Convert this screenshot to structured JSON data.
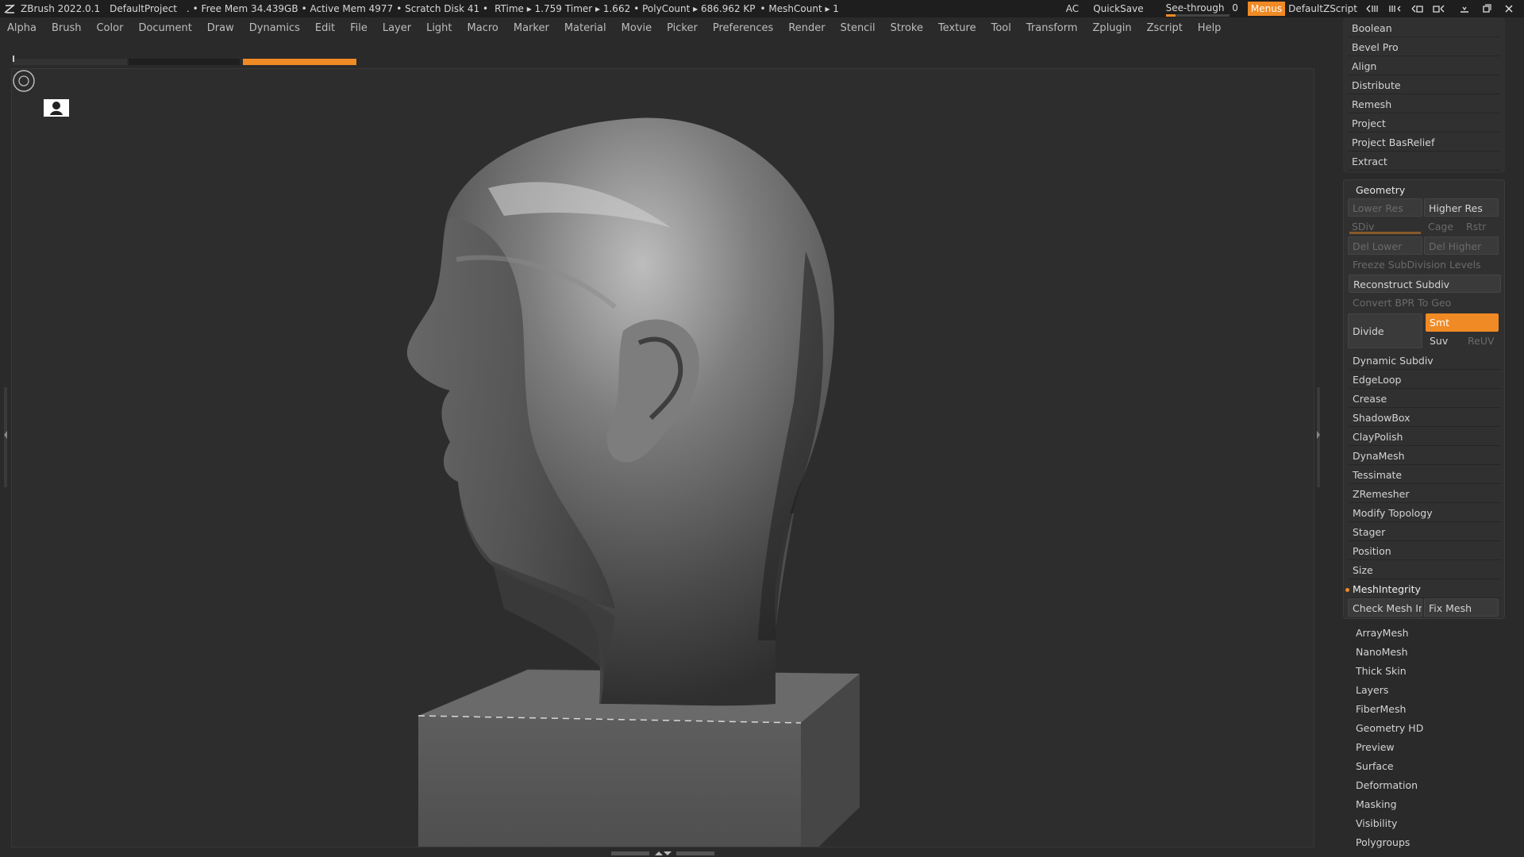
{
  "titlebar": {
    "app": "ZBrush 2022.0.1",
    "project": "DefaultProject",
    "free_mem": ". • Free Mem 34.439GB",
    "active_mem": "• Active Mem 4977",
    "scratch": "• Scratch Disk 41 •",
    "rtime": "RTime ▸ 1.759",
    "timer": "Timer ▸ 1.662",
    "polycount": "• PolyCount ▸ 686.962 KP",
    "meshcount": "• MeshCount ▸ 1",
    "ac": "AC",
    "quicksave": "QuickSave",
    "seethrough": "See-through",
    "seethrough_value": "0",
    "menus": "Menus",
    "zscript": "DefaultZScript"
  },
  "menubar": [
    "Alpha",
    "Brush",
    "Color",
    "Document",
    "Draw",
    "Dynamics",
    "Edit",
    "File",
    "Layer",
    "Light",
    "Macro",
    "Marker",
    "Material",
    "Movie",
    "Picker",
    "Preferences",
    "Render",
    "Stencil",
    "Stroke",
    "Texture",
    "Tool",
    "Transform",
    "Zplugin",
    "Zscript",
    "Help"
  ],
  "palette": {
    "top_items": [
      "Boolean",
      "Bevel Pro",
      "Align",
      "Distribute",
      "Remesh",
      "Project",
      "Project BasRelief",
      "Extract"
    ],
    "geometry": {
      "header": "Geometry",
      "lower_res": "Lower Res",
      "higher_res": "Higher Res",
      "sdiv": "SDiv",
      "cage": "Cage",
      "rstr": "Rstr",
      "del_lower": "Del Lower",
      "del_higher": "Del Higher",
      "freeze": "Freeze SubDivision Levels",
      "reconstruct": "Reconstruct Subdiv",
      "convert_bpr": "Convert BPR To Geo",
      "divide": "Divide",
      "smt": "Smt",
      "suv": "Suv",
      "reuv": "ReUV",
      "items": [
        "Dynamic Subdiv",
        "EdgeLoop",
        "Crease",
        "ShadowBox",
        "ClayPolish",
        "DynaMesh",
        "Tessimate",
        "ZRemesher",
        "Modify Topology",
        "Stager",
        "Position",
        "Size"
      ],
      "meshintegrity": "MeshIntegrity",
      "check_mesh": "Check Mesh Inte",
      "fix_mesh": "Fix Mesh"
    },
    "sub_items": [
      "ArrayMesh",
      "NanoMesh",
      "Thick Skin",
      "Layers",
      "FiberMesh",
      "Geometry HD",
      "Preview",
      "Surface",
      "Deformation",
      "Masking",
      "Visibility",
      "Polygroups"
    ]
  },
  "colors": {
    "accent": "#f08a24",
    "bg": "#2a2a2a",
    "panel": "#303030"
  },
  "icons": [
    "zbrush-logo-icon",
    "perspective-icon",
    "navigation-gizmo-icon",
    "window-controls-icon"
  ]
}
